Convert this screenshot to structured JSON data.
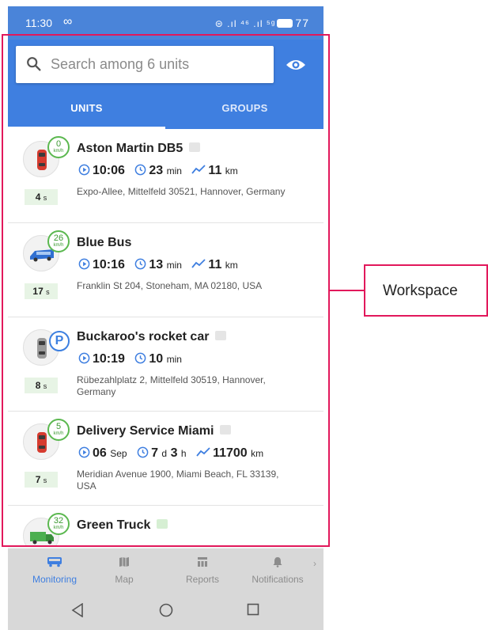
{
  "status_bar": {
    "time": "11:30",
    "infinity": "∞",
    "network": "⊜ .ıl ⁴⁶ .ıl ⁵ᵍ",
    "battery": "77"
  },
  "search": {
    "placeholder": "Search among 6 units",
    "value": ""
  },
  "tabs": [
    {
      "label": "UNITS",
      "active": true
    },
    {
      "label": "GROUPS",
      "active": false
    }
  ],
  "units": [
    {
      "name": "Aston Martin DB5",
      "key_icon": "gray",
      "icon": "red-car-icon",
      "state": "moving",
      "speed": "0",
      "speed_unit": "km/h",
      "time": "10:06",
      "duration_value": "23",
      "duration_unit": "min",
      "distance_value": "11",
      "distance_unit": "km",
      "address": "Expo-Allee, Mittelfeld 30521, Hannover, Germany",
      "ago_value": "4",
      "ago_unit": "s"
    },
    {
      "name": "Blue Bus",
      "key_icon": "none",
      "icon": "blue-bus-icon",
      "state": "moving",
      "speed": "26",
      "speed_unit": "km/h",
      "time": "10:16",
      "duration_value": "13",
      "duration_unit": "min",
      "distance_value": "11",
      "distance_unit": "km",
      "address": "Franklin St 204, Stoneham, MA 02180, USA",
      "ago_value": "17",
      "ago_unit": "s"
    },
    {
      "name": "Buckaroo's rocket car",
      "key_icon": "gray",
      "icon": "gray-car-icon",
      "state": "parked",
      "parking_label": "P",
      "time": "10:19",
      "duration_value": "10",
      "duration_unit": "min",
      "address": "Rübezahlplatz 2, Mittelfeld 30519, Hannover, Germany",
      "ago_value": "8",
      "ago_unit": "s"
    },
    {
      "name": "Delivery Service Miami",
      "key_icon": "gray",
      "icon": "red-car-icon",
      "state": "moving",
      "speed": "5",
      "speed_unit": "km/h",
      "date_value": "06",
      "date_unit": "Sep",
      "duration_parts": [
        "7",
        "d",
        "3",
        "h"
      ],
      "distance_value": "11700",
      "distance_unit": "km",
      "address": "Meridian Avenue 1900, Miami Beach, FL 33139, USA",
      "ago_value": "7",
      "ago_unit": "s"
    },
    {
      "name": "Green Truck",
      "key_icon": "green",
      "icon": "green-truck-icon",
      "state": "moving",
      "speed": "32",
      "speed_unit": "km/h"
    }
  ],
  "bottom_nav": [
    {
      "label": "Monitoring",
      "icon": "bus-icon",
      "active": true
    },
    {
      "label": "Map",
      "icon": "map-icon",
      "active": false
    },
    {
      "label": "Reports",
      "icon": "reports-icon",
      "active": false
    },
    {
      "label": "Notifications",
      "icon": "bell-icon",
      "active": false
    }
  ],
  "nav_more": "›",
  "annotation": {
    "label": "Workspace",
    "color": "#e2185b"
  },
  "colors": {
    "primary": "#3f7fe0",
    "moving_green": "#5bb84f",
    "parking_blue": "#3c7fe0",
    "ago_bg": "#e7f4e5"
  }
}
